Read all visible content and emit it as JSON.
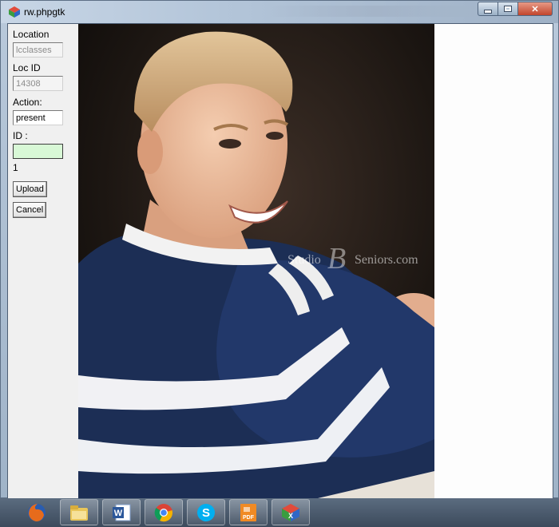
{
  "window": {
    "title": "rw.phpgtk"
  },
  "form": {
    "location_label": "Location",
    "location_value": "lcclasses",
    "locid_label": "Loc ID",
    "locid_value": "14308",
    "action_label": "Action:",
    "action_value": "present",
    "id_label": "ID :",
    "id_value": "",
    "count": "1",
    "upload_label": "Upload",
    "cancel_label": "Cancel"
  },
  "photo": {
    "watermark_studio": "Studio",
    "watermark_monogram": "B",
    "watermark_seniors": "Seniors.com"
  },
  "taskbar": {
    "items": [
      {
        "icon": "firefox-icon"
      },
      {
        "icon": "file-explorer-icon"
      },
      {
        "icon": "word-icon"
      },
      {
        "icon": "chrome-icon"
      },
      {
        "icon": "skype-icon"
      },
      {
        "icon": "pdf-icon"
      },
      {
        "icon": "php-gtk-icon"
      }
    ]
  },
  "colors": {
    "active_field_bg": "#d8f8d6",
    "window_frame": "#b3c5d9",
    "close_button": "#c2452c"
  }
}
